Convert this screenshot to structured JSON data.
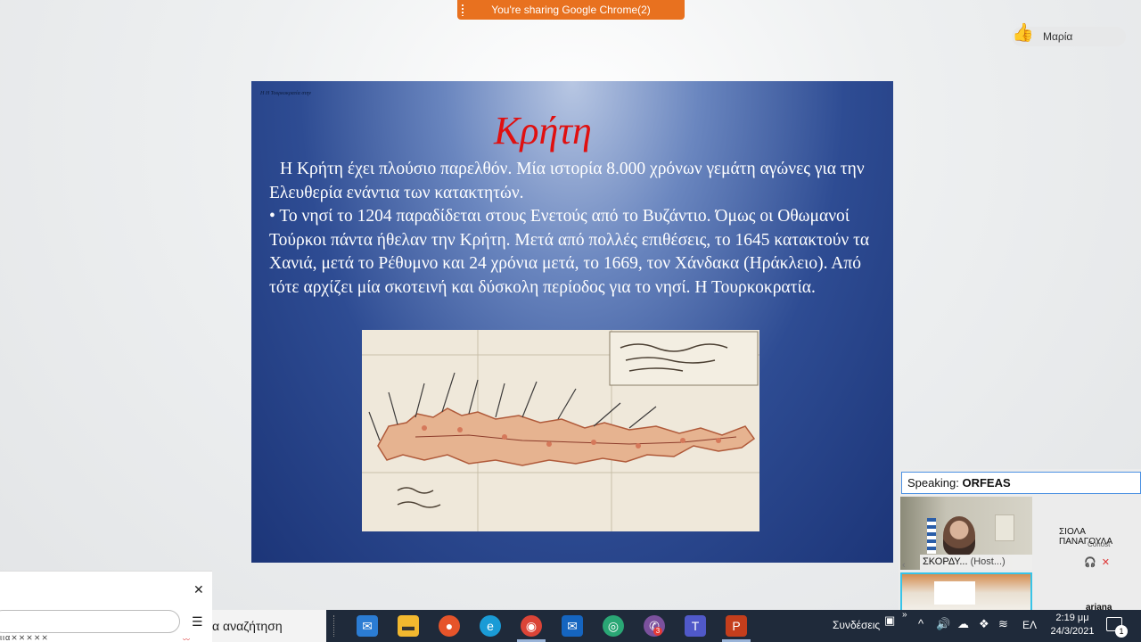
{
  "sharing_banner": {
    "text": "You're sharing Google Chrome(2)",
    "color": "#e8711f"
  },
  "user_pill": {
    "name": "Μαρία",
    "icon": "thumbs-up-icon"
  },
  "slide": {
    "header": "Η Η Τουρκοκρατία στην",
    "title": "Κρήτη",
    "title_color": "#e01010",
    "paragraph_1": "Η Κρήτη έχει πλούσιο παρελθόν. Μία ιστορία 8.000 χρόνων γεμάτη αγώνες για την Ελευθερία ενάντια των κατακτητών.",
    "paragraph_2": "• Το νησί το 1204 παραδίδεται στους Ενετούς από το Βυζάντιο. Όμως οι Οθωμανοί Τούρκοι πάντα ήθελαν την Κρήτη. Μετά από πολλές επιθέσεις, το 1645 κατακτούν τα Χανιά, μετά το Ρέθυμνο και 24 χρόνια μετά, το 1669, τον Χάνδακα (Ηράκλειο). Από τότε αρχίζει μία σκοτεινή και δύσκολη περίοδος για το νησί. Η Τουρκοκρατία."
  },
  "zoom": {
    "speaking_label": "Speaking:",
    "speaking_name": "ORFEAS",
    "host_name": "ΣΚΟΡΔΥ...",
    "host_role": "(Host...)",
    "cohost_name": "ΣΙΟΛΑ ΠΑΝΑΓΟΥΛΑ",
    "cohost_role": "Cohost",
    "third_participant": "ariana"
  },
  "dialog": {
    "close_icon": "close-icon"
  },
  "search_panel": {
    "garbled_text": "ιια⨯⨯⨯⨯⨯"
  },
  "taskbar": {
    "search_text": "α αναζήτηση",
    "connections_label": "Συνδέσεις",
    "language": "ΕΛ",
    "time": "2:19 μμ",
    "date": "24/3/2021",
    "notification_count": "1",
    "apps": [
      "mail-icon",
      "file-explorer-icon",
      "firefox-icon",
      "edge-icon",
      "chrome-icon",
      "outlook-icon",
      "browser-icon",
      "viber-icon",
      "teams-icon",
      "powerpoint-icon"
    ],
    "viber_badge": "3"
  }
}
